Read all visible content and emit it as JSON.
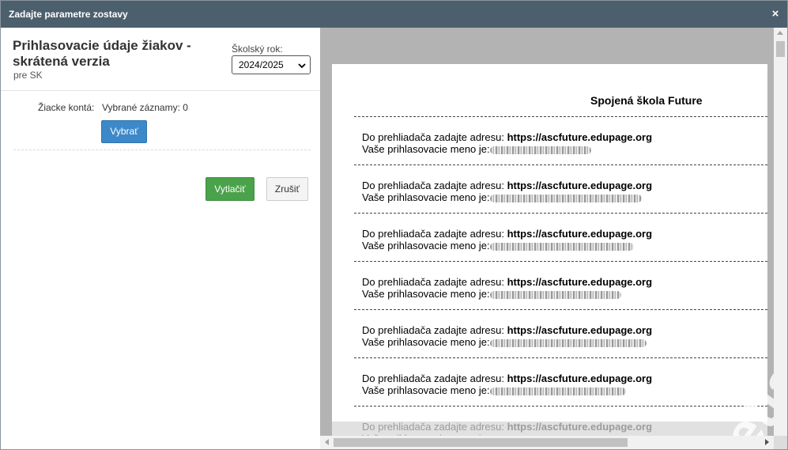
{
  "window": {
    "title": "Zadajte parametre zostavy",
    "close_icon": "×"
  },
  "form": {
    "heading": "Prihlasovacie údaje žiakov - skrátená verzia",
    "subheading": "pre SK",
    "year_label": "Školský rok:",
    "year_value": "2024/2025",
    "accounts_label": "Žiacke kontá:",
    "accounts_value": "Vybrané záznamy: 0",
    "select_button": "Vybrať",
    "print_button": "Vytlačiť",
    "cancel_button": "Zrušiť"
  },
  "preview": {
    "school": "Spojená škola Future",
    "address_prefix": "Do prehliadača zadajte adresu:",
    "address": "https://ascfuture.edupage.org",
    "login_prefix": "Vaše prihlasovacie meno je:",
    "watermark": "etla"
  },
  "colors": {
    "titlebar": "#4c5f6d",
    "primary_button": "#3d88c8",
    "success_button": "#4aa24a",
    "preview_background": "#b3b3b3"
  }
}
